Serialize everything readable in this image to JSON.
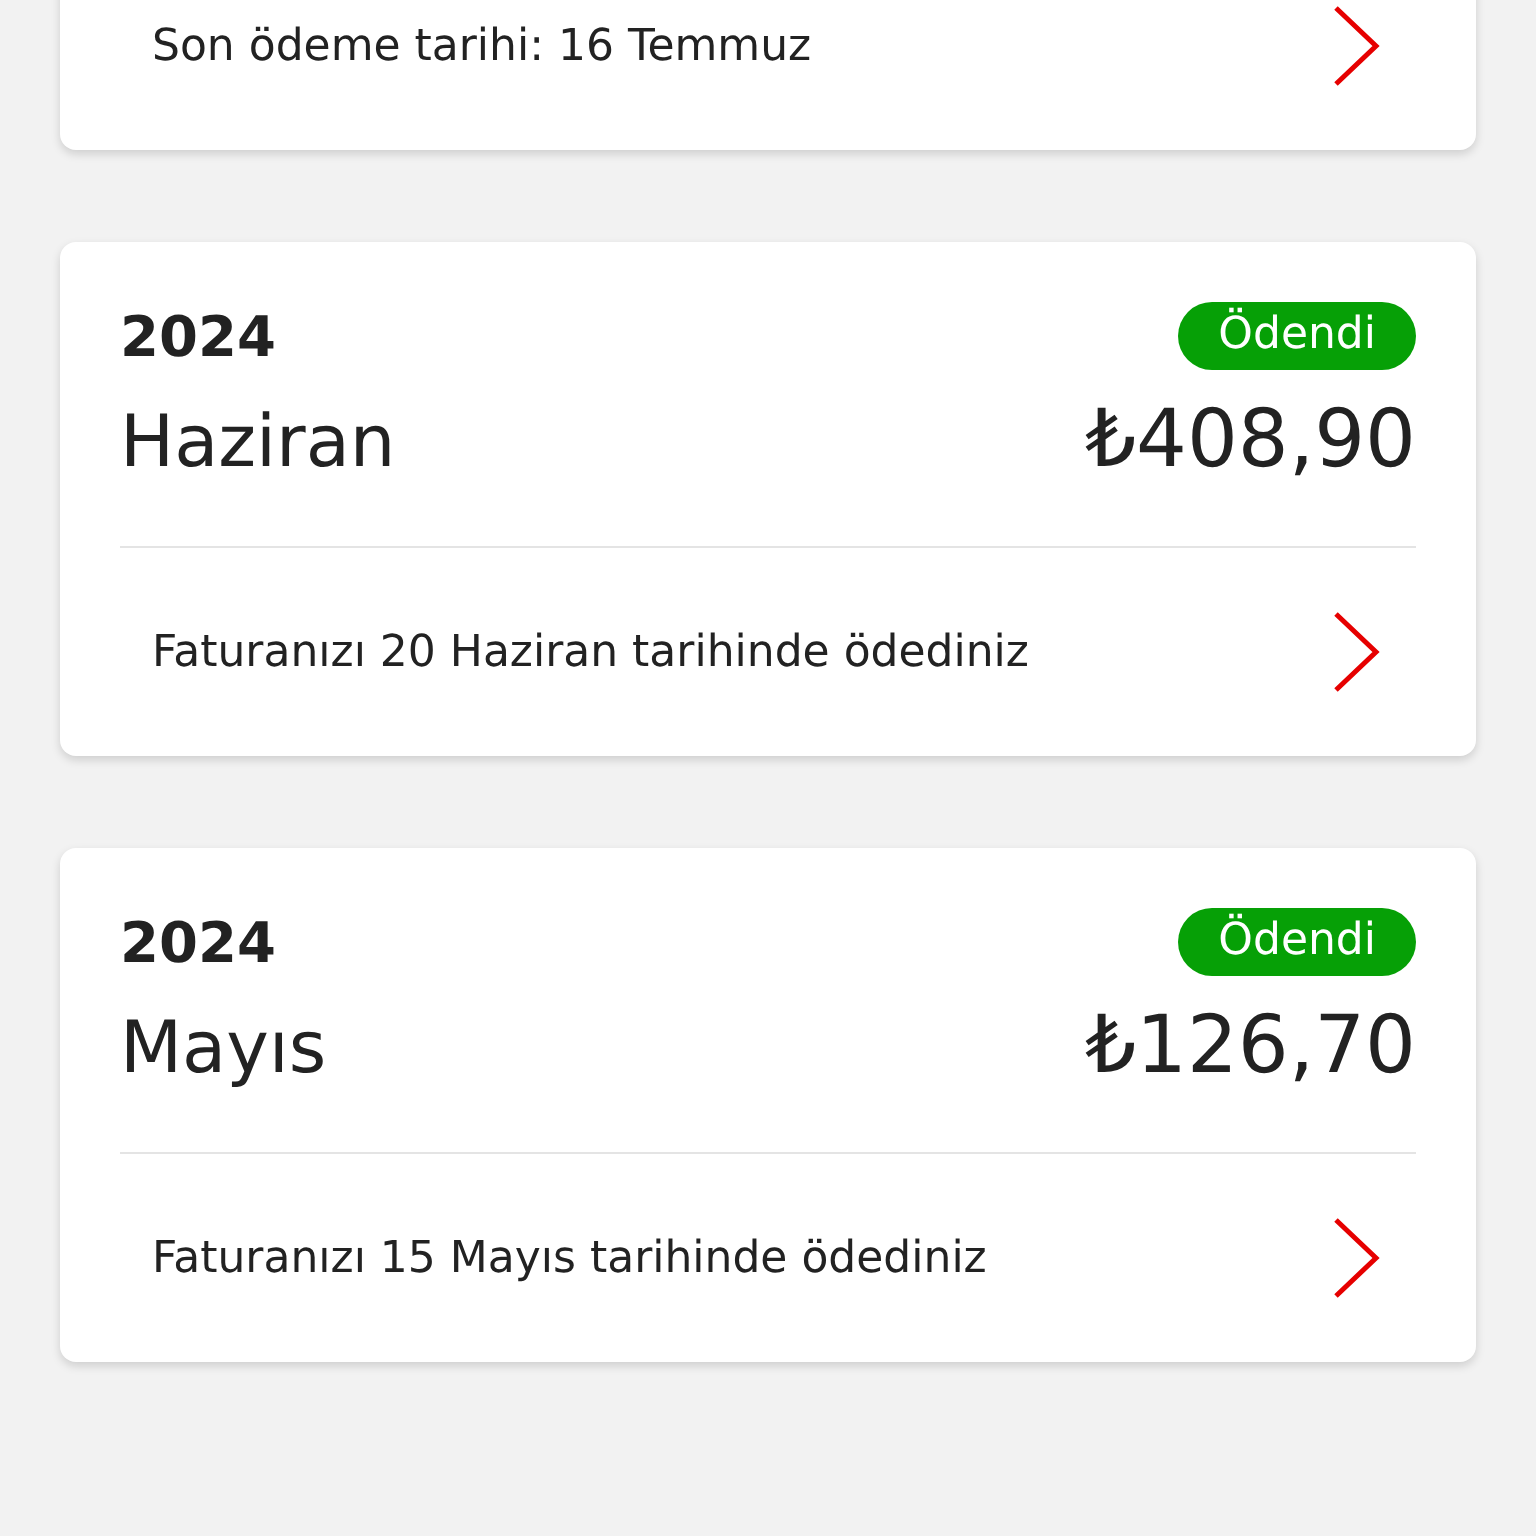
{
  "bills": [
    {
      "kind": "partial",
      "note": "Son ödeme tarihi: 16 Temmuz"
    },
    {
      "kind": "full",
      "year": "2024",
      "status": "Ödendi",
      "paid": true,
      "month": "Haziran",
      "amount": "₺408,90",
      "note": "Faturanızı 20 Haziran tarihinde ödediniz"
    },
    {
      "kind": "full",
      "year": "2024",
      "status": "Ödendi",
      "paid": true,
      "month": "Mayıs",
      "amount": "₺126,70",
      "note": "Faturanızı 15 Mayıs tarihinde ödediniz"
    }
  ]
}
